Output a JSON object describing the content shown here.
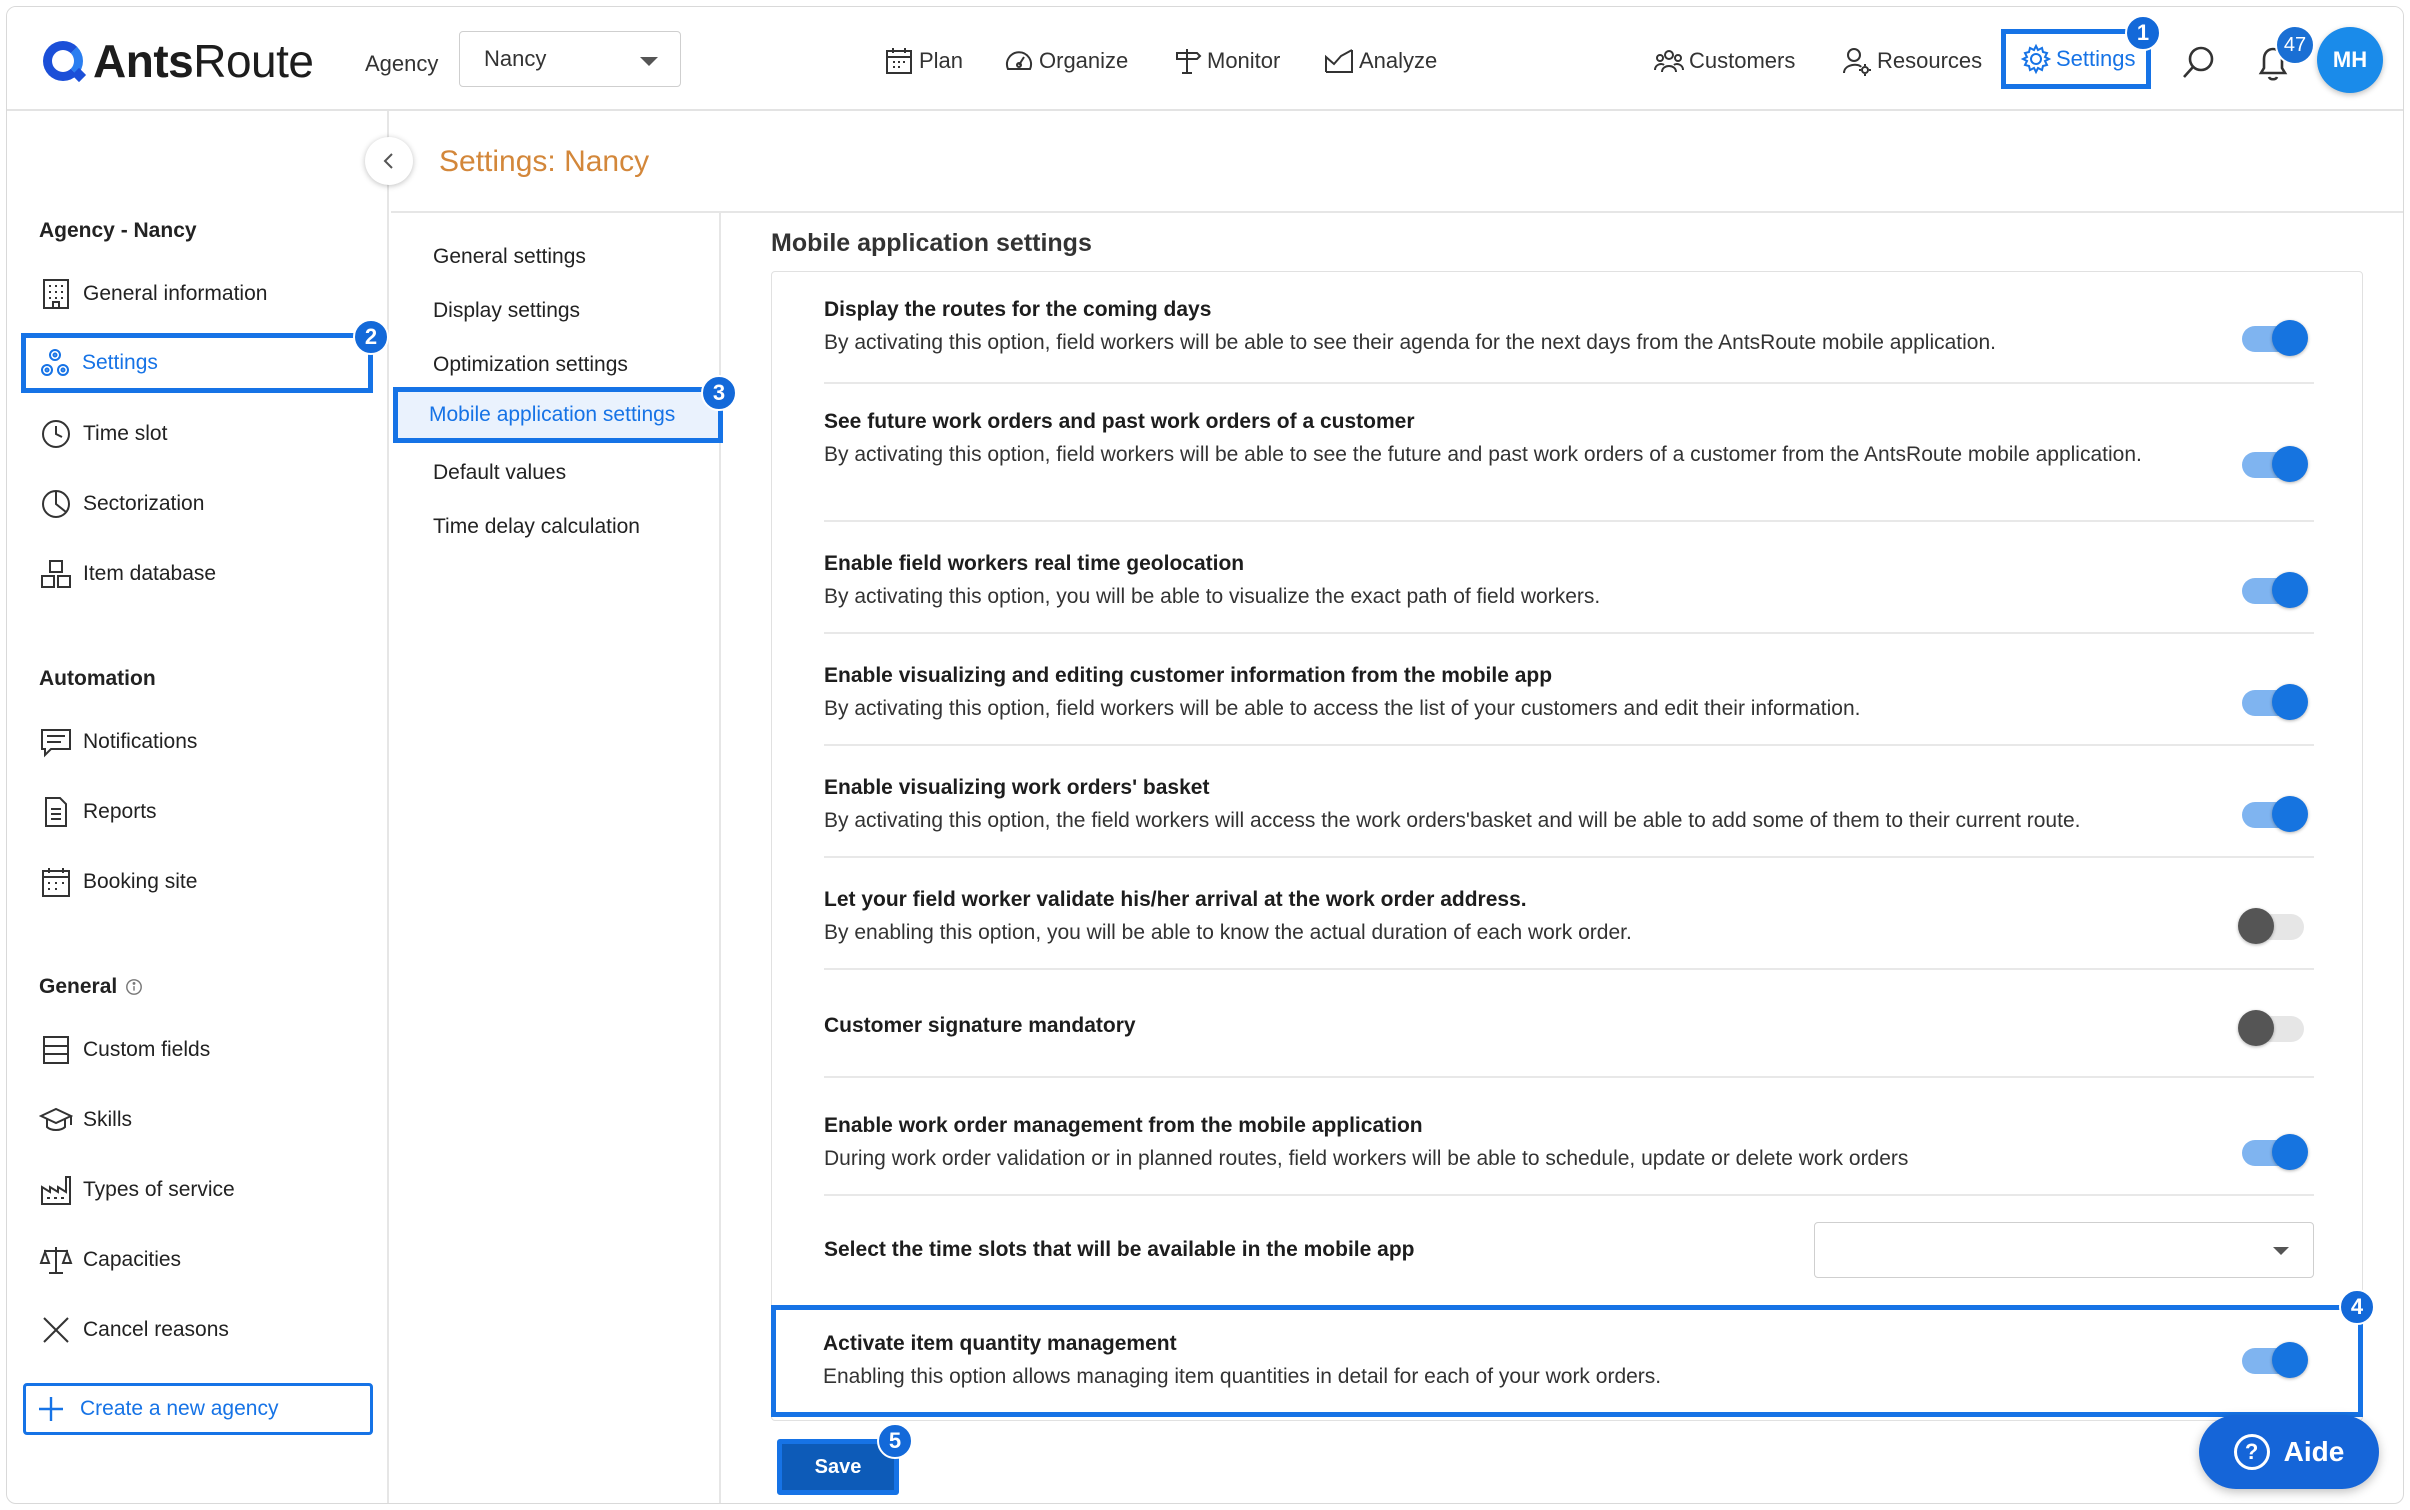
{
  "brand": {
    "name_bold": "Ants",
    "name_rest": "Route"
  },
  "header": {
    "agency_label": "Agency",
    "agency_value": "Nancy",
    "nav": {
      "plan": "Plan",
      "organize": "Organize",
      "monitor": "Monitor",
      "analyze": "Analyze",
      "customers": "Customers",
      "resources": "Resources",
      "settings": "Settings"
    },
    "notification_count": "47",
    "avatar_initials": "MH"
  },
  "callouts": {
    "c1": "1",
    "c2": "2",
    "c3": "3",
    "c4": "4",
    "c5": "5"
  },
  "sidebar": {
    "agency_heading": "Agency - Nancy",
    "items_agency": [
      {
        "label": "General information"
      },
      {
        "label": "Settings"
      },
      {
        "label": "Time slot"
      },
      {
        "label": "Sectorization"
      },
      {
        "label": "Item database"
      }
    ],
    "automation_heading": "Automation",
    "items_automation": [
      {
        "label": "Notifications"
      },
      {
        "label": "Reports"
      },
      {
        "label": "Booking site"
      }
    ],
    "general_heading": "General",
    "items_general": [
      {
        "label": "Custom fields"
      },
      {
        "label": "Skills"
      },
      {
        "label": "Types of service"
      },
      {
        "label": "Capacities"
      },
      {
        "label": "Cancel reasons"
      }
    ],
    "create_agency": "Create a new agency"
  },
  "page_title": "Settings: Nancy",
  "subnav": [
    {
      "label": "General settings"
    },
    {
      "label": "Display settings"
    },
    {
      "label": "Optimization settings"
    },
    {
      "label": "Mobile application settings"
    },
    {
      "label": "Default values"
    },
    {
      "label": "Time delay calculation"
    }
  ],
  "main": {
    "heading": "Mobile application settings",
    "settings": [
      {
        "title": "Display the routes for the coming days",
        "description": "By activating this option, field workers will be able to see their agenda for the next days from the AntsRoute mobile application.",
        "enabled": true
      },
      {
        "title": "See future work orders and past work orders of a customer",
        "description": "By activating this option, field workers will be able to see the future and past work orders of a customer from the AntsRoute mobile application.",
        "enabled": true
      },
      {
        "title": "Enable field workers real time geolocation",
        "description": "By activating this option, you will be able to visualize the exact path of field workers.",
        "enabled": true
      },
      {
        "title": "Enable visualizing and editing customer information from the mobile app",
        "description": "By activating this option, field workers will be able to access the list of your customers and edit their information.",
        "enabled": true
      },
      {
        "title": "Enable visualizing work orders' basket",
        "description": "By activating this option, the field workers will access the work orders'basket and will be able to add some of them to their current route.",
        "enabled": true
      },
      {
        "title": "Let your field worker validate his/her arrival at the work order address.",
        "description": "By enabling this option, you will be able to know the actual duration of each work order.",
        "enabled": false
      },
      {
        "title": "Customer signature mandatory",
        "description": "",
        "enabled": false
      },
      {
        "title": "Enable work order management from the mobile application",
        "description": "During work order validation or in planned routes, field workers will be able to schedule, update or delete work orders",
        "enabled": true
      },
      {
        "title": "Select the time slots that will be available in the mobile app",
        "description": "",
        "select_value": ""
      },
      {
        "title": "Activate item quantity management",
        "description": "Enabling this option allows managing item quantities in detail for each of your work orders.",
        "enabled": true
      }
    ],
    "save_label": "Save"
  },
  "help": {
    "label": "Aide",
    "glyph": "?"
  },
  "colors": {
    "accent": "#1673e6",
    "title_orange": "#d3873a",
    "toggle_on": "#1674e0",
    "toggle_off": "#555555"
  }
}
